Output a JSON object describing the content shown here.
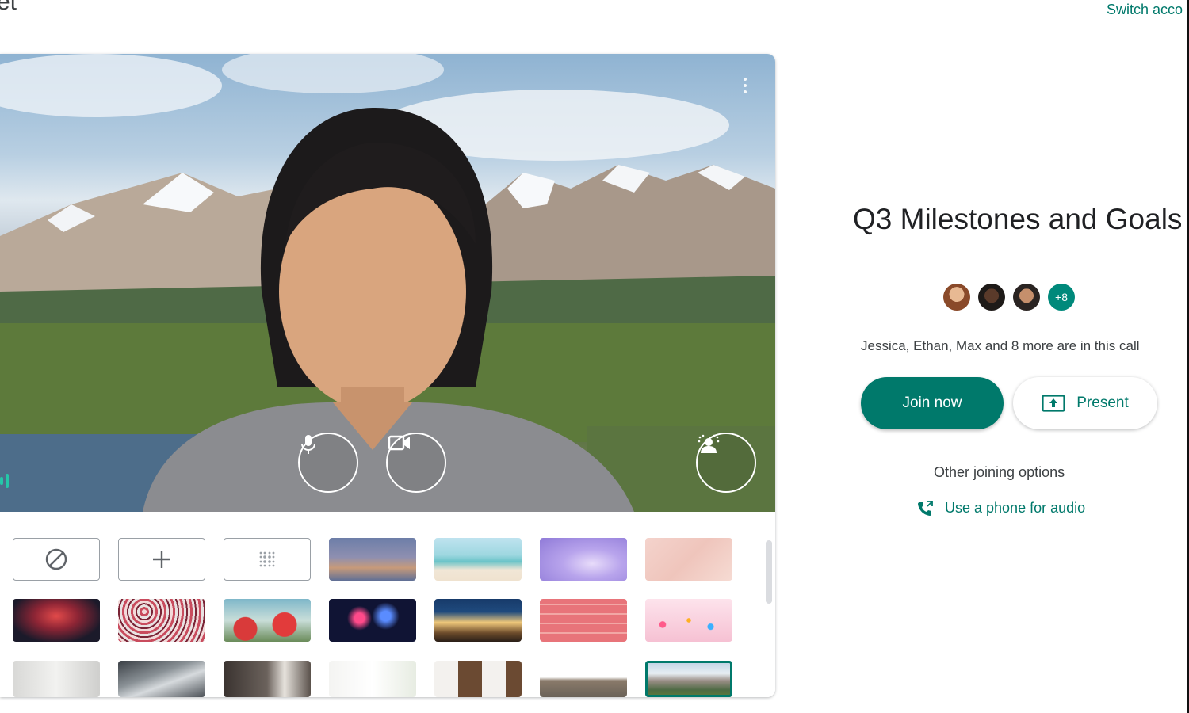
{
  "header": {
    "brand_partial": "et",
    "switch_account": "Switch acco"
  },
  "preview": {
    "controls": {
      "mic": "mic-icon",
      "camera": "camera-icon",
      "effects": "background-effects-icon"
    }
  },
  "backgrounds": {
    "row1": [
      {
        "name": "no-effect",
        "kind": "option",
        "icon": "⊘"
      },
      {
        "name": "upload-background",
        "kind": "option",
        "icon": "+"
      },
      {
        "name": "blur",
        "kind": "option",
        "icon": "⁘"
      },
      {
        "name": "sunset-gradient",
        "kind": "image"
      },
      {
        "name": "beach",
        "kind": "image"
      },
      {
        "name": "purple-clouds",
        "kind": "image"
      },
      {
        "name": "pink-texture",
        "kind": "image"
      }
    ],
    "row2": [
      {
        "name": "galaxy",
        "kind": "image"
      },
      {
        "name": "confetti-pattern",
        "kind": "image"
      },
      {
        "name": "flowers",
        "kind": "image"
      },
      {
        "name": "fireworks",
        "kind": "image"
      },
      {
        "name": "night-shop",
        "kind": "image"
      },
      {
        "name": "pink-grid",
        "kind": "image"
      },
      {
        "name": "sprinkles",
        "kind": "image"
      }
    ],
    "row3": [
      {
        "name": "white-room",
        "kind": "image"
      },
      {
        "name": "skylight",
        "kind": "image"
      },
      {
        "name": "dark-room",
        "kind": "image"
      },
      {
        "name": "bright-room",
        "kind": "image"
      },
      {
        "name": "bookshelf",
        "kind": "image"
      },
      {
        "name": "houses",
        "kind": "image"
      },
      {
        "name": "mountains",
        "kind": "image",
        "selected": true
      }
    ]
  },
  "meeting": {
    "title": "Q3 Milestones and Goals",
    "more_count": "+8",
    "in_call_text": "Jessica, Ethan, Max and 8 more are in this call",
    "join_label": "Join now",
    "present_label": "Present",
    "other_options_label": "Other joining options",
    "phone_audio_label": "Use a phone for audio"
  },
  "colors": {
    "accent": "#00796b"
  }
}
